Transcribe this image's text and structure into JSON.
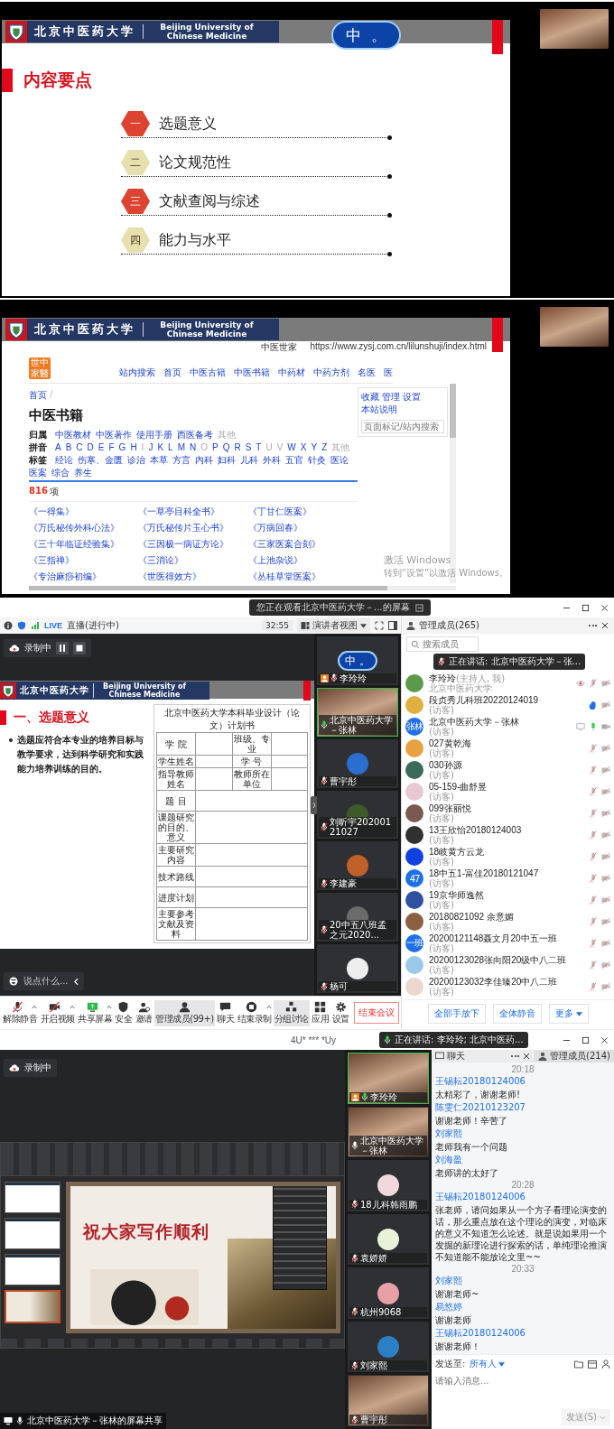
{
  "lecture_slide_screen": {
    "university": {
      "name_cn": "北京中医药大学",
      "name_en": "Beijing University of Chinese Medicine"
    },
    "ime": {
      "mode": "中",
      "punct": "。"
    },
    "title": "内容要点",
    "items": [
      {
        "badge": "一",
        "label": "选题意义",
        "color": "#dc4431"
      },
      {
        "badge": "二",
        "label": "论文规范性",
        "color": "#e6dfae"
      },
      {
        "badge": "三",
        "label": "文献查阅与综述",
        "color": "#dc4431"
      },
      {
        "badge": "四",
        "label": "能力与水平",
        "color": "#e6dfae"
      }
    ]
  },
  "website_screen": {
    "university": {
      "name_cn": "北京中医药大学",
      "name_en": "Beijing University of Chinese Medicine"
    },
    "site_name": "中医世家",
    "url": "https://www.zysj.com.cn/lilunshuji/index.html",
    "logo": "世中家醫",
    "nav": [
      "站内搜索",
      "首页",
      "中医古籍",
      "中医书籍",
      "中药材",
      "中药方剂",
      "名医",
      "医"
    ],
    "breadcrumb": "首页",
    "breadcrumb_separator": "/",
    "side_links": [
      "收藏",
      "管理",
      "设置",
      "本站说明"
    ],
    "search_placeholder": "页面标记/站内搜索",
    "heading": "中医书籍",
    "filters": [
      {
        "label": "归属",
        "options": [
          {
            "text": "中医教材",
            "disabled": false
          },
          {
            "text": "中医著作",
            "disabled": false
          },
          {
            "text": "使用手册",
            "disabled": false
          },
          {
            "text": "西医备考",
            "disabled": false
          },
          {
            "text": "其他",
            "disabled": true
          }
        ]
      },
      {
        "label": "拼音",
        "options": [
          {
            "text": "A",
            "disabled": false
          },
          {
            "text": "B",
            "disabled": false
          },
          {
            "text": "C",
            "disabled": false
          },
          {
            "text": "D",
            "disabled": false
          },
          {
            "text": "E",
            "disabled": false
          },
          {
            "text": "F",
            "disabled": false
          },
          {
            "text": "G",
            "disabled": false
          },
          {
            "text": "H",
            "disabled": false
          },
          {
            "text": "I",
            "disabled": true
          },
          {
            "text": "J",
            "disabled": false
          },
          {
            "text": "K",
            "disabled": false
          },
          {
            "text": "L",
            "disabled": false
          },
          {
            "text": "M",
            "disabled": false
          },
          {
            "text": "N",
            "disabled": false
          },
          {
            "text": "O",
            "disabled": true
          },
          {
            "text": "P",
            "disabled": false
          },
          {
            "text": "Q",
            "disabled": false
          },
          {
            "text": "R",
            "disabled": false
          },
          {
            "text": "S",
            "disabled": false
          },
          {
            "text": "T",
            "disabled": false
          },
          {
            "text": "U",
            "disabled": true
          },
          {
            "text": "V",
            "disabled": true
          },
          {
            "text": "W",
            "disabled": false
          },
          {
            "text": "X",
            "disabled": false
          },
          {
            "text": "Y",
            "disabled": false
          },
          {
            "text": "Z",
            "disabled": false
          },
          {
            "text": "其他",
            "disabled": true
          }
        ]
      },
      {
        "label": "标签",
        "options": [
          {
            "text": "经论",
            "disabled": false
          },
          {
            "text": "伤寒、金匮",
            "disabled": false
          },
          {
            "text": "诊治",
            "disabled": false
          },
          {
            "text": "本草",
            "disabled": false
          },
          {
            "text": "方言",
            "disabled": false
          },
          {
            "text": "内科",
            "disabled": false
          },
          {
            "text": "妇科",
            "disabled": false
          },
          {
            "text": "儿科",
            "disabled": false
          },
          {
            "text": "外科",
            "disabled": false
          },
          {
            "text": "五官",
            "disabled": false
          },
          {
            "text": "针灸",
            "disabled": false
          },
          {
            "text": "医论",
            "disabled": false
          },
          {
            "text": "医案",
            "disabled": false
          },
          {
            "text": "综合",
            "disabled": false
          },
          {
            "text": "养生",
            "disabled": false
          }
        ]
      }
    ],
    "count": "816",
    "count_unit": "项",
    "books": [
      "《一得集》",
      "《一草亭目科全书》",
      "《丁甘仁医案》",
      "《万氏秘传外科心法》",
      "《万氏秘传片玉心书》",
      "《万病回春》",
      "《三十年临证经验集》",
      "《三因极一病证方论》",
      "《三家医案合刻》",
      "《三指禅》",
      "《三消论》",
      "《上池杂说》",
      "《专治麻痧初编》",
      "《世医得效方》",
      "《丛桂草堂医案》"
    ],
    "activation": {
      "title": "激活 Windows",
      "hint": "转到“设置”以激活 Windows。"
    }
  },
  "meeting_screen": {
    "viewing_banner": "您正在观看北京中医药大学－...的屏幕",
    "live": "LIVE",
    "live_status": "直播(进行中)",
    "timer": "32:55",
    "view_mode": "演讲者视图",
    "recording": "录制中",
    "slide": {
      "university": {
        "name_cn": "北京中医药大学",
        "name_en": "Beijing University of Chinese Medicine"
      },
      "heading": "一、选题意义",
      "bullet": "选题应符合本专业的培养目标与教学要求，达到科学研究和实践能力培养训练的目的。",
      "form": {
        "title": "北京中医药大学本科毕业设计（论文）计划书",
        "rows": [
          {
            "labels": [
              "学 院",
              "班级、专业"
            ]
          },
          {
            "labels": [
              "学生姓名",
              "学 号"
            ]
          },
          {
            "labels": [
              "指导教师姓名",
              "教师所在单位"
            ]
          },
          {
            "labels": [
              "题 目"
            ]
          },
          {
            "labels": [
              "课题研究的目的、意义"
            ]
          },
          {
            "labels": [
              "主要研究内容"
            ]
          },
          {
            "labels": [
              "技术路线"
            ]
          },
          {
            "labels": [
              "进度计划"
            ]
          },
          {
            "labels": [
              "主要参考文献及资料"
            ]
          }
        ]
      }
    },
    "chat_input_placeholder": "说点什么...",
    "tiles": [
      {
        "kind": "ime",
        "ime_mode": "中",
        "ime_punct": "。",
        "name": "李玲玲",
        "host": true,
        "muted": true,
        "speaking": false
      },
      {
        "kind": "video",
        "name": "北京中医药大学－张林",
        "host": false,
        "muted": false,
        "speaking": true
      },
      {
        "kind": "avatar",
        "color": "#2a6fd0",
        "name": "曹宇彤",
        "host": false,
        "muted": true,
        "speaking": false
      },
      {
        "kind": "avatar",
        "color": "#3e5a2a",
        "name": "刘昕宇20200121027",
        "host": false,
        "muted": true,
        "speaking": false
      },
      {
        "kind": "avatar",
        "color": "#c0602a",
        "name": "李建豪",
        "host": false,
        "muted": true,
        "speaking": false
      },
      {
        "kind": "avatar",
        "color": "#6b6b6b",
        "name": "20中五八班孟之元2020...",
        "host": false,
        "muted": true,
        "speaking": false
      },
      {
        "kind": "avatar",
        "color": "#eeeeee",
        "name": "杨可",
        "host": false,
        "muted": true,
        "speaking": false
      }
    ],
    "toolbar": [
      {
        "kind": "mic_muted",
        "label": "解除静音",
        "active": false,
        "menu": true
      },
      {
        "kind": "video_off",
        "label": "开启视频",
        "active": false,
        "menu": true
      },
      {
        "kind": "share",
        "label": "共享屏幕",
        "active": false,
        "menu": true
      },
      {
        "kind": "shield",
        "label": "安全",
        "active": false,
        "menu": false
      },
      {
        "kind": "invite",
        "label": "邀请",
        "active": false,
        "menu": false
      },
      {
        "kind": "members",
        "label": "管理成员(99+)",
        "active": true,
        "menu": false
      },
      {
        "kind": "chat",
        "label": "聊天",
        "active": false,
        "menu": false
      },
      {
        "kind": "record",
        "label": "结束录制",
        "active": false,
        "menu": true
      },
      {
        "kind": "groups",
        "label": "分组讨论",
        "active": true,
        "menu": false
      },
      {
        "kind": "apps",
        "label": "应用",
        "active": false,
        "menu": false
      },
      {
        "kind": "settings",
        "label": "设置",
        "active": false,
        "menu": false
      }
    ],
    "end_button": "结束会议",
    "members_panel": {
      "title": "管理成员(265)",
      "search_placeholder": "搜索成员",
      "speaking_toast": "正在讲话: 北京中医药大学－张...",
      "members": [
        {
          "name": "李玲玲",
          "role": "(主持人, 我)",
          "subtitle": "北京中医药大学",
          "kind": "host",
          "color": "#5a9a4a"
        },
        {
          "name": "段贞秀儿科班20220124019",
          "subtitle": "(访客)",
          "kind": "hand",
          "color": "#e0b040"
        },
        {
          "name": "北京中医药大学－张林",
          "subtitle": "(访客)",
          "kind": "speaking",
          "color": "#1f6fe8",
          "avatar_text": "张林"
        },
        {
          "name": "027黄乾海",
          "subtitle": "(访客)",
          "kind": "muted",
          "color": "#e8a040"
        },
        {
          "name": "030孙源",
          "subtitle": "(访客)",
          "kind": "muted",
          "color": "#3a6a5a"
        },
        {
          "name": "05-159-曲舒昱",
          "subtitle": "(访客)",
          "kind": "muted",
          "color": "#e8c8d0"
        },
        {
          "name": "099张丽悦",
          "subtitle": "(访客)",
          "kind": "muted",
          "color": "#7a5a50"
        },
        {
          "name": "13王欣怡20180124003",
          "subtitle": "(访客)",
          "kind": "muted",
          "color": "#303030"
        },
        {
          "name": "18岐黄方云龙",
          "subtitle": "(访客)",
          "kind": "muted",
          "color": "#1040e0"
        },
        {
          "name": "18中五1-富佳20180121047",
          "subtitle": "(访客)",
          "kind": "muted",
          "color": "#1f6fe8",
          "avatar_text": "47"
        },
        {
          "name": "19京华师逸然",
          "subtitle": "(访客)",
          "kind": "muted",
          "color": "#3050a0"
        },
        {
          "name": "20180821092 余意媚",
          "subtitle": "(访客)",
          "kind": "muted",
          "color": "#8a6040"
        },
        {
          "name": "20200121148聂文月20中五一班",
          "subtitle": "(访客)",
          "kind": "muted",
          "color": "#1f6fe8",
          "avatar_text": "一班"
        },
        {
          "name": "20200123028张向阳20级中八二班",
          "subtitle": "(访客)",
          "kind": "muted",
          "color": "#9ac8e8"
        },
        {
          "name": "20200123032李佳臻20中八二班",
          "subtitle": "(访客)",
          "kind": "muted",
          "color": "#e8d8d0"
        }
      ],
      "buttons": [
        {
          "label": "全部手放下",
          "menu": false
        },
        {
          "label": "全体静音",
          "menu": false
        },
        {
          "label": "更多",
          "menu": true
        }
      ]
    }
  },
  "chat_screen": {
    "window_title": "4U* *** *Uy",
    "speaking_toast": "正在讲话: 李玲玲; 北京中医药...",
    "recording": "录制中",
    "slide_text": "祝大家写作顺利",
    "share_label": "北京中医药大学－张林的屏幕共享",
    "tiles": [
      {
        "kind": "video",
        "name": "李玲玲",
        "host": true,
        "muted": false,
        "speaking": true
      },
      {
        "kind": "video",
        "name": "北京中医药大学－张林",
        "host": false,
        "muted": false,
        "speaking": false
      },
      {
        "kind": "avatar",
        "color": "#f1d8dc",
        "name": "18儿科韩雨鹏",
        "host": false,
        "muted": true,
        "speaking": false
      },
      {
        "kind": "avatar",
        "color": "#e8f2d8",
        "name": "袁娇娇",
        "host": false,
        "muted": true,
        "speaking": false
      },
      {
        "kind": "avatar",
        "color": "#e8a0a8",
        "name": "杭州9068",
        "host": false,
        "muted": true,
        "speaking": false
      },
      {
        "kind": "avatar",
        "color": "#2b7fc4",
        "name": "刘家熙",
        "host": false,
        "muted": true,
        "speaking": false
      },
      {
        "kind": "video",
        "name": "曹宇彤",
        "host": false,
        "muted": true,
        "speaking": false
      }
    ],
    "chat_tab": "聊天",
    "members_tab": "管理成员(214)",
    "messages": [
      {
        "kind": "time",
        "text": "20:18"
      },
      {
        "kind": "message",
        "sender": "王锡耘20180124006",
        "text": "太精彩了，谢谢老师!"
      },
      {
        "kind": "message",
        "sender": "陈雯仁20210123207",
        "text": "谢谢老师！辛苦了"
      },
      {
        "kind": "message",
        "sender": "刘家熙",
        "text": "老师我有一个问题"
      },
      {
        "kind": "message",
        "sender": "刘海盈",
        "text": "老师讲的太好了"
      },
      {
        "kind": "time",
        "text": "20:28"
      },
      {
        "kind": "message",
        "sender": "王锡耘20180124006",
        "text": "张老师，请问如果从一个方子看理论演变的话，那么重点放在这个理论的演变，对临床的意义不知道怎么论述。就是说如果用一个发掘的新理论进行探索的话，单纯理论推演不知道能不能放论文里~~"
      },
      {
        "kind": "time",
        "text": "20:33"
      },
      {
        "kind": "message",
        "sender": "刘家熙",
        "text": "谢谢老师~"
      },
      {
        "kind": "message",
        "sender": "易悠婷",
        "text": "谢谢老师"
      },
      {
        "kind": "message",
        "sender": "王锡耘20180124006",
        "text": "谢谢老师！"
      }
    ],
    "send_to_label": "发送至:",
    "recipient": "所有人",
    "input_placeholder": "请输入消息...",
    "send_button": "发送(S)"
  }
}
